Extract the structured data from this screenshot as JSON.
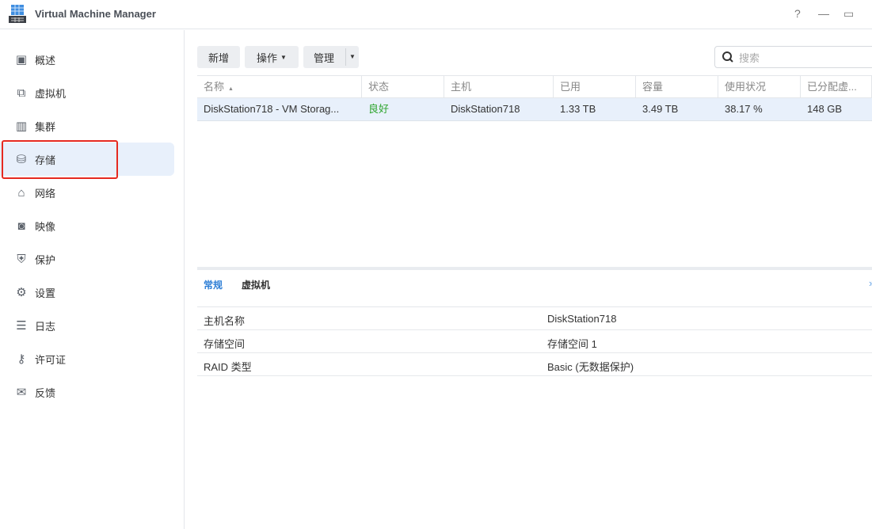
{
  "window": {
    "title": "Virtual Machine Manager",
    "help": "?",
    "minimize": "—",
    "maximize": "▭"
  },
  "sidebar": {
    "items": [
      {
        "label": "概述",
        "icon": "overview-icon"
      },
      {
        "label": "虚拟机",
        "icon": "vm-icon"
      },
      {
        "label": "集群",
        "icon": "cluster-icon"
      },
      {
        "label": "存储",
        "icon": "storage-icon",
        "active": true
      },
      {
        "label": "网络",
        "icon": "network-icon"
      },
      {
        "label": "映像",
        "icon": "image-icon"
      },
      {
        "label": "保护",
        "icon": "shield-icon"
      },
      {
        "label": "设置",
        "icon": "gear-icon"
      },
      {
        "label": "日志",
        "icon": "list-icon"
      },
      {
        "label": "许可证",
        "icon": "key-icon"
      },
      {
        "label": "反馈",
        "icon": "mail-icon"
      }
    ]
  },
  "toolbar": {
    "add": "新增",
    "action": "操作",
    "manage": "管理",
    "search_placeholder": "搜索"
  },
  "table": {
    "columns": [
      "名称",
      "状态",
      "主机",
      "已用",
      "容量",
      "使用状况",
      "已分配虚..."
    ],
    "rows": [
      [
        "DiskStation718 - VM Storag...",
        "良好",
        "DiskStation718",
        "1.33 TB",
        "3.49 TB",
        "38.17 %",
        "148 GB"
      ]
    ]
  },
  "colors": {
    "status_ok": "#2fa52f",
    "accent": "#2f7fd6",
    "highlight": "#e52a20"
  },
  "details": {
    "tabs": [
      "常规",
      "虚拟机"
    ],
    "rows": [
      {
        "label": "主机名称",
        "value": "DiskStation718"
      },
      {
        "label": "存储空间",
        "value": "存储空间 1"
      },
      {
        "label": "RAID 类型",
        "value": "Basic (无数据保护)"
      }
    ]
  }
}
